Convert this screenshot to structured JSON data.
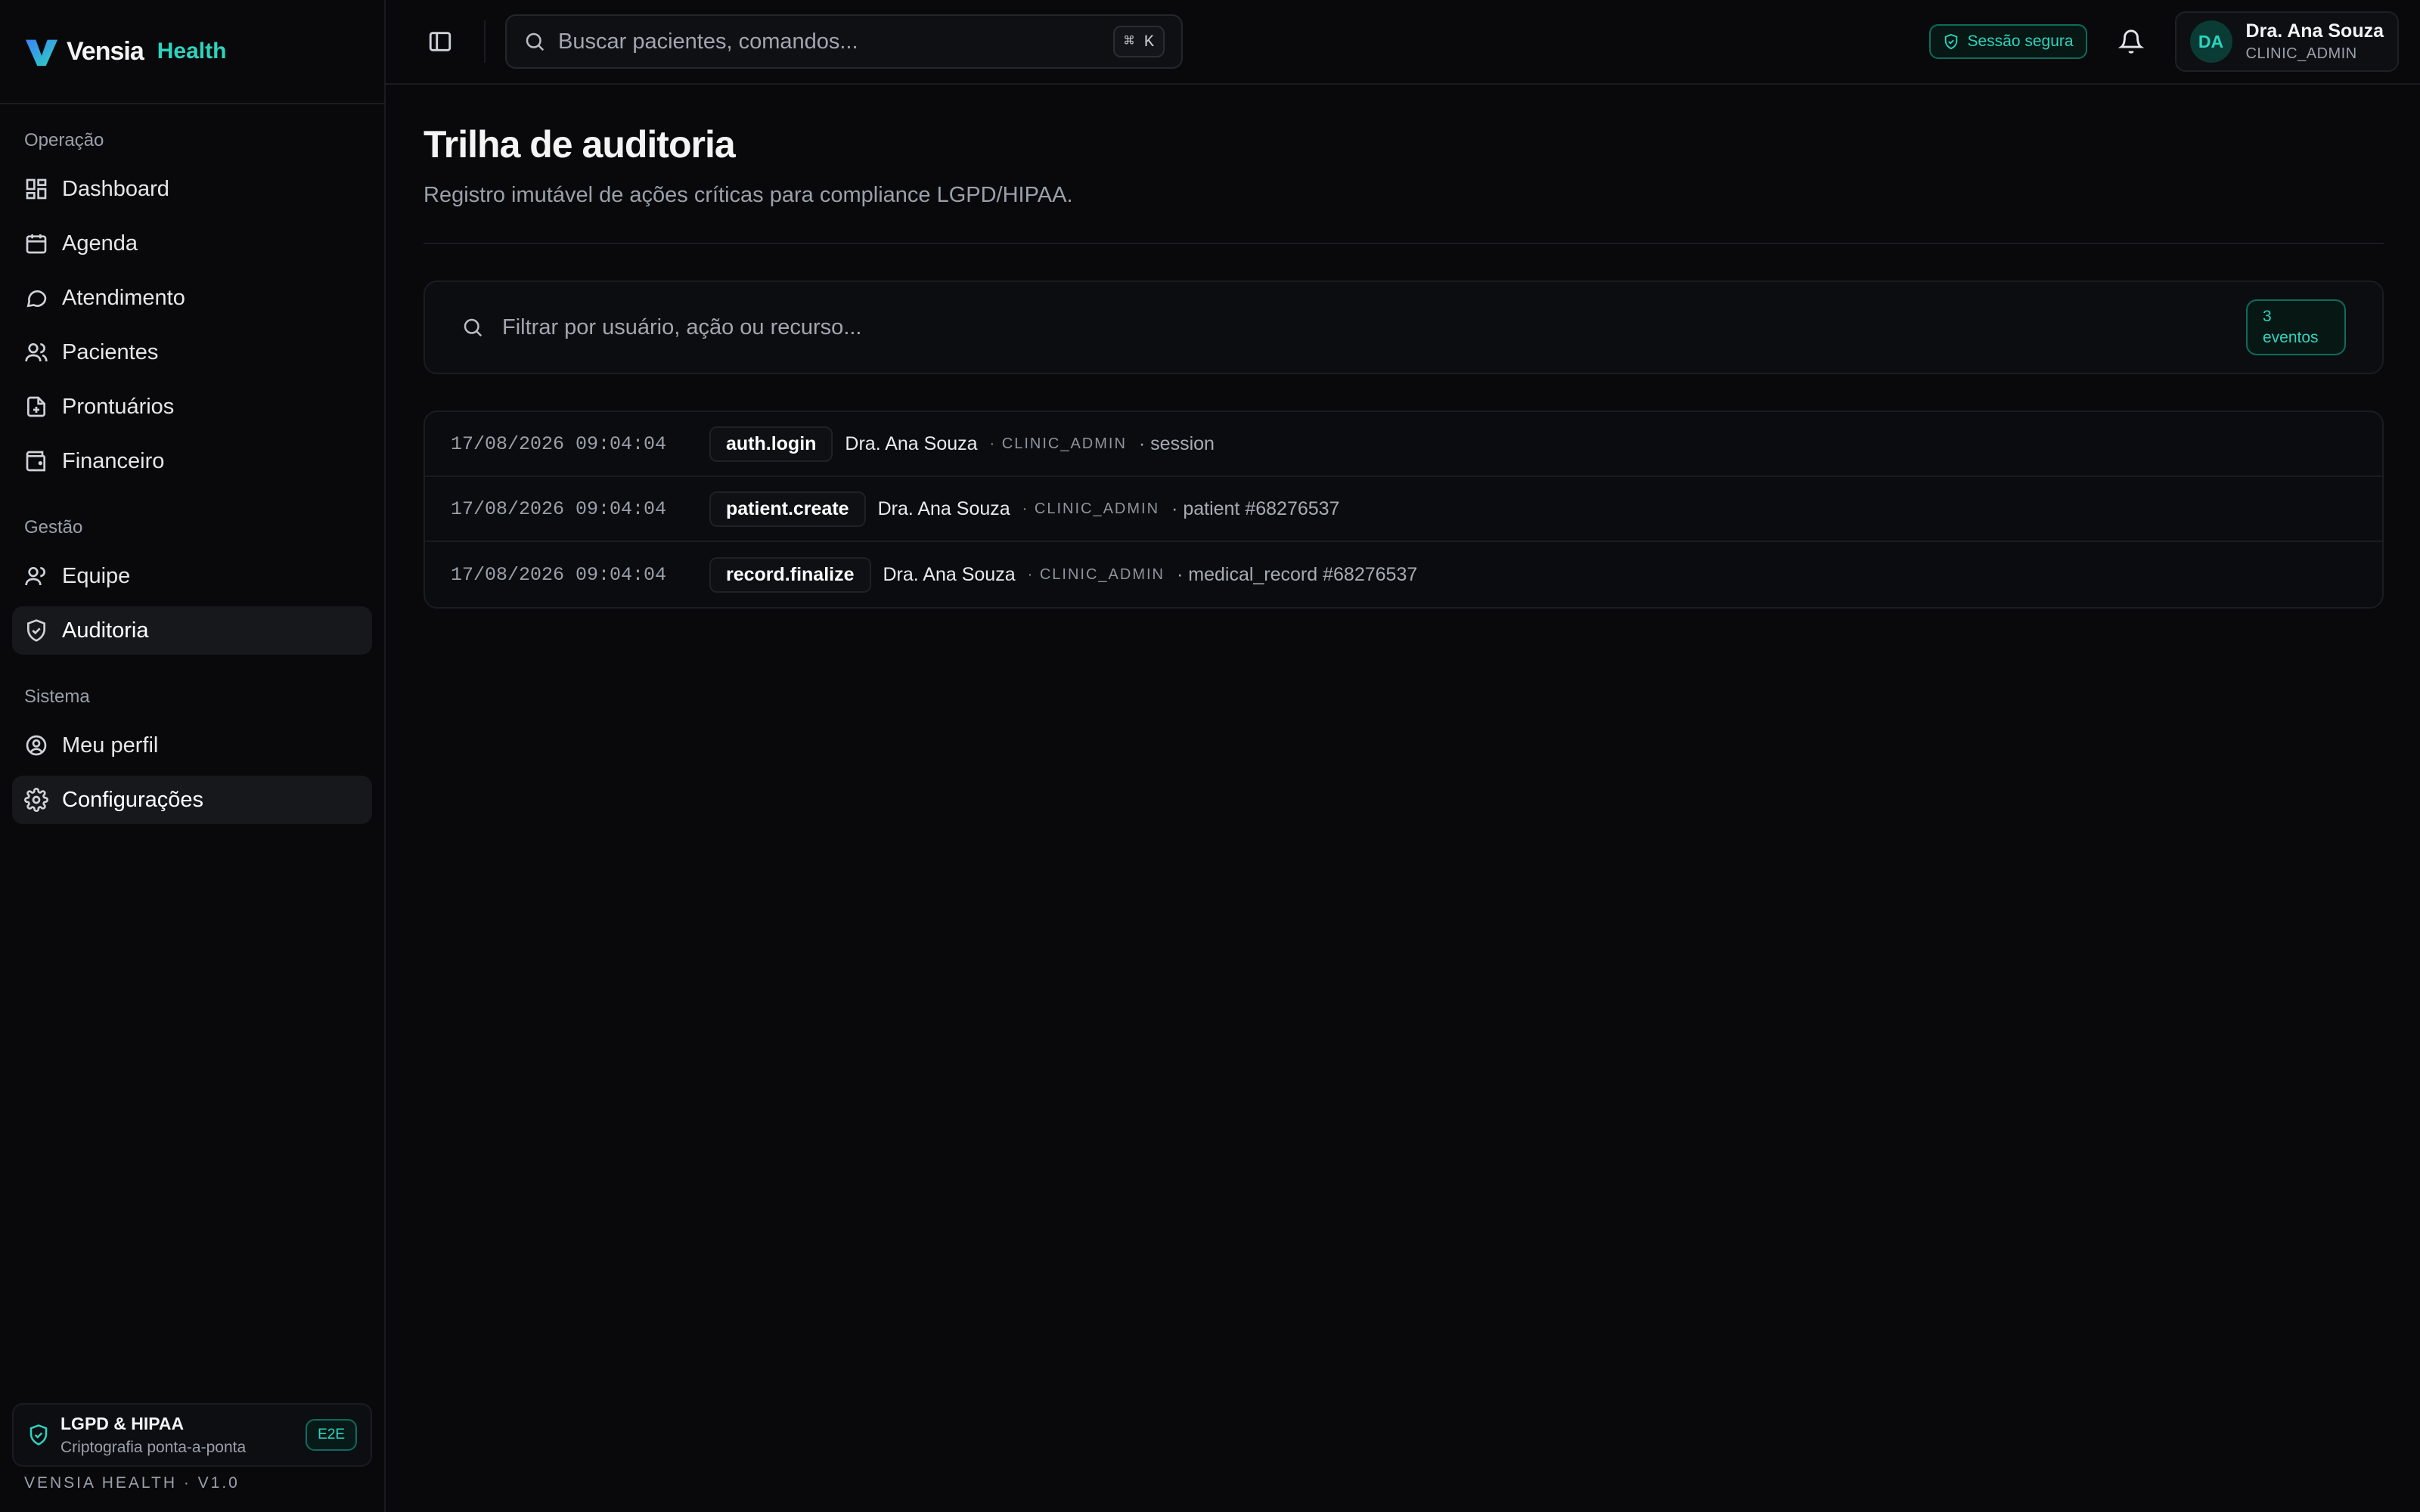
{
  "brand": {
    "name": "Vensia",
    "suffix": "Health"
  },
  "sidebar": {
    "sections": [
      {
        "title": "Operação",
        "items": [
          {
            "label": "Dashboard"
          },
          {
            "label": "Agenda"
          },
          {
            "label": "Atendimento"
          },
          {
            "label": "Pacientes"
          },
          {
            "label": "Prontuários"
          },
          {
            "label": "Financeiro"
          }
        ]
      },
      {
        "title": "Gestão",
        "items": [
          {
            "label": "Equipe"
          },
          {
            "label": "Auditoria"
          }
        ]
      },
      {
        "title": "Sistema",
        "items": [
          {
            "label": "Meu perfil"
          },
          {
            "label": "Configurações"
          }
        ]
      }
    ],
    "compliance": {
      "title": "LGPD & HIPAA",
      "subtitle": "Criptografia ponta-a-ponta",
      "badge": "E2E"
    },
    "version": "VENSIA HEALTH · V1.0"
  },
  "topbar": {
    "search_placeholder": "Buscar pacientes, comandos...",
    "shortcut": "⌘ K",
    "secure_badge": "Sessão segura",
    "user": {
      "initials": "DA",
      "name": "Dra. Ana Souza",
      "role": "CLINIC_ADMIN"
    }
  },
  "page": {
    "title": "Trilha de auditoria",
    "subtitle": "Registro imutável de ações críticas para compliance LGPD/HIPAA.",
    "filter_placeholder": "Filtrar por usuário, ação ou recurso...",
    "count_line1": "3",
    "count_line2": "eventos"
  },
  "audit_events": [
    {
      "timestamp": "17/08/2026 09:04:04",
      "action": "auth.login",
      "user": "Dra. Ana Souza",
      "role": "· CLINIC_ADMIN",
      "resource": "· session"
    },
    {
      "timestamp": "17/08/2026 09:04:04",
      "action": "patient.create",
      "user": "Dra. Ana Souza",
      "role": "· CLINIC_ADMIN",
      "resource": "· patient #68276537"
    },
    {
      "timestamp": "17/08/2026 09:04:04",
      "action": "record.finalize",
      "user": "Dra. Ana Souza",
      "role": "· CLINIC_ADMIN",
      "resource": "· medical_record #68276537"
    }
  ],
  "colors": {
    "accent": "#2dd4bf",
    "background": "#09090b",
    "active_item": "#17181c"
  }
}
